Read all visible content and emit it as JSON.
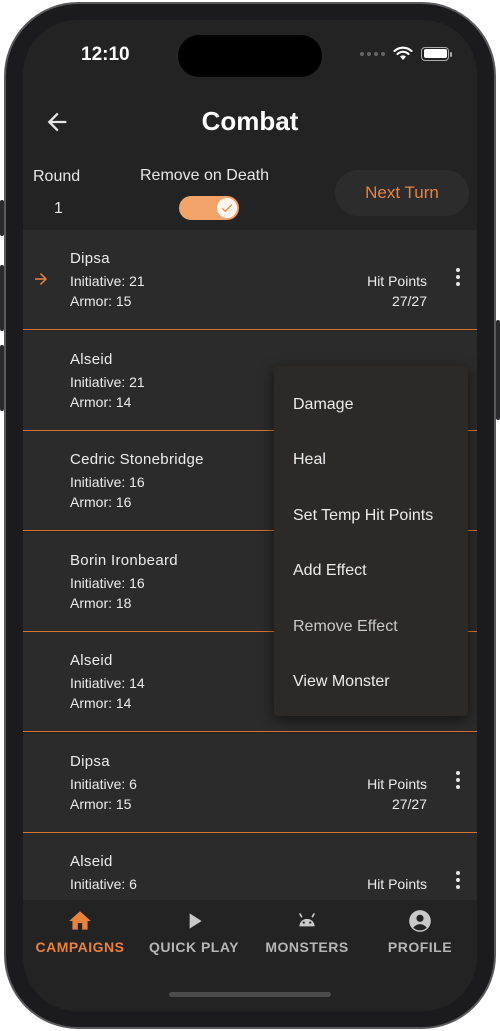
{
  "status_bar": {
    "time": "12:10"
  },
  "header": {
    "title": "Combat"
  },
  "controls": {
    "round_label": "Round",
    "round_value": "1",
    "remove_on_death_label": "Remove on Death",
    "remove_on_death_on": true,
    "next_turn_label": "Next Turn"
  },
  "combatants": [
    {
      "name": "Dipsa",
      "initiative": "Initiative: 21",
      "armor": "Armor: 15",
      "hp_label": "Hit Points",
      "hp_value": "27/27",
      "current_turn": true
    },
    {
      "name": "Alseid",
      "initiative": "Initiative: 21",
      "armor": "Armor: 14"
    },
    {
      "name": "Cedric Stonebridge",
      "initiative": "Initiative: 16",
      "armor": "Armor: 16"
    },
    {
      "name": "Borin Ironbeard",
      "initiative": "Initiative: 16",
      "armor": "Armor: 18"
    },
    {
      "name": "Alseid",
      "initiative": "Initiative: 14",
      "armor": "Armor: 14"
    },
    {
      "name": "Dipsa",
      "initiative": "Initiative: 6",
      "armor": "Armor: 15",
      "hp_label": "Hit Points",
      "hp_value": "27/27"
    },
    {
      "name": "Alseid",
      "initiative": "Initiative: 6",
      "armor": "",
      "hp_label": "Hit Points",
      "hp_value": ""
    }
  ],
  "context_menu": {
    "items": [
      "Damage",
      "Heal",
      "Set Temp Hit Points",
      "Add Effect",
      "Remove Effect",
      "View Monster"
    ]
  },
  "bottom_nav": {
    "items": [
      {
        "label": "CAMPAIGNS",
        "icon": "home-icon",
        "active": true
      },
      {
        "label": "QUICK PLAY",
        "icon": "play-icon",
        "active": false
      },
      {
        "label": "MONSTERS",
        "icon": "android-icon",
        "active": false
      },
      {
        "label": "PROFILE",
        "icon": "account-circle-icon",
        "active": false
      }
    ]
  },
  "colors": {
    "accent": "#e9823a",
    "background": "#232323",
    "row": "#2b2b2b",
    "divider": "#d8732f",
    "toggle": "#f2a36a"
  }
}
